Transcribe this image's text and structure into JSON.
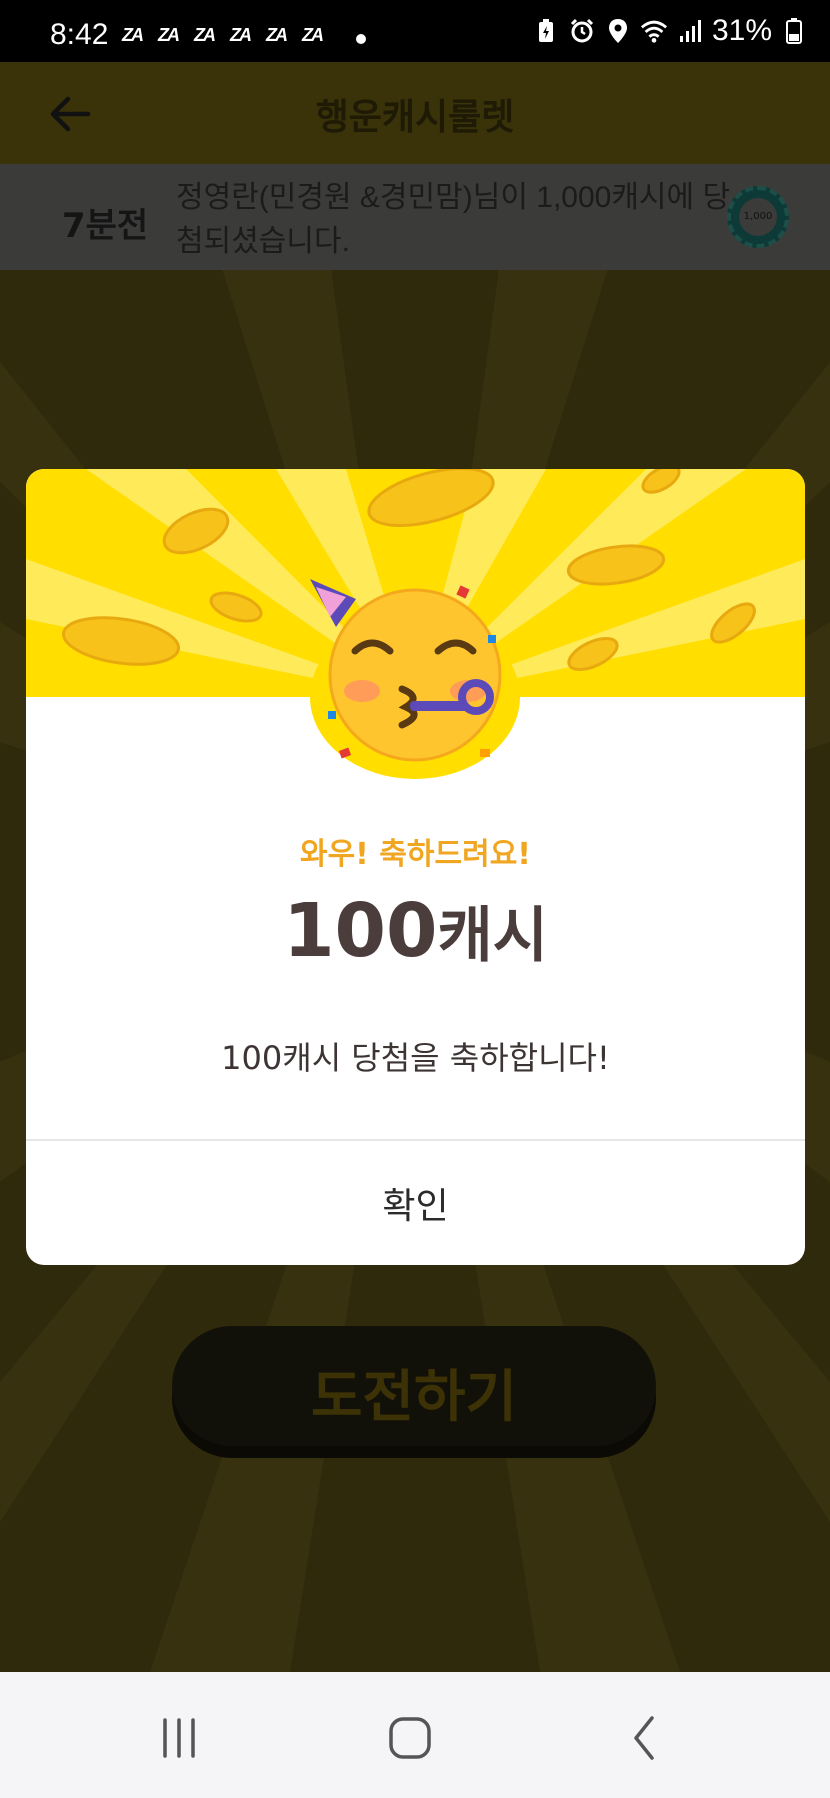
{
  "status_bar": {
    "time": "8:42",
    "battery": "31%",
    "notification_icon_text": "ZA"
  },
  "header": {
    "title": "행운캐시룰렛"
  },
  "ticker": {
    "time": "7분전",
    "message": "정영란(민경원 &경민맘)님이 1,000캐시에 당첨되셨습니다.",
    "coin_label": "1,000"
  },
  "main": {
    "challenge_label": "도전하기"
  },
  "modal": {
    "heading": "와우! 축하드려요!",
    "amount_number": "100",
    "amount_unit": "캐시",
    "description": "100캐시 당첨을 축하합니다!",
    "confirm_label": "확인"
  },
  "colors": {
    "accent_yellow": "#ffde00",
    "heading_orange": "#f0a620",
    "amount_text": "#4a3d3b"
  },
  "icons": {
    "back": "back-arrow-icon",
    "emoji": "party-face-emoji",
    "nav_recent": "recent-apps-icon",
    "nav_home": "home-icon",
    "nav_back": "back-icon"
  }
}
